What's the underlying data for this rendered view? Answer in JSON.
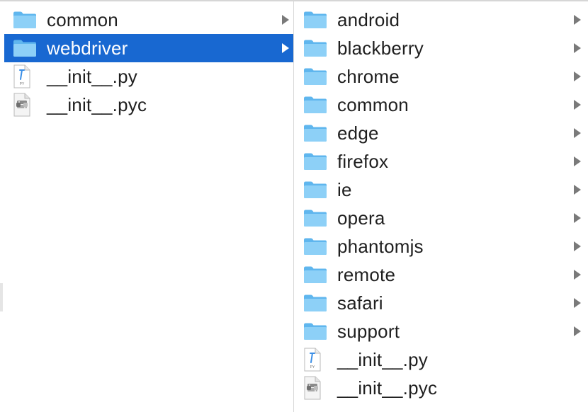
{
  "column1": {
    "items": [
      {
        "label": "common",
        "type": "folder",
        "has_children": true,
        "selected": false
      },
      {
        "label": "webdriver",
        "type": "folder",
        "has_children": true,
        "selected": true
      },
      {
        "label": "__init__.py",
        "type": "python-file",
        "has_children": false,
        "selected": false
      },
      {
        "label": "__init__.pyc",
        "type": "compiled-python-file",
        "has_children": false,
        "selected": false
      }
    ]
  },
  "column2": {
    "items": [
      {
        "label": "android",
        "type": "folder",
        "has_children": true
      },
      {
        "label": "blackberry",
        "type": "folder",
        "has_children": true
      },
      {
        "label": "chrome",
        "type": "folder",
        "has_children": true
      },
      {
        "label": "common",
        "type": "folder",
        "has_children": true
      },
      {
        "label": "edge",
        "type": "folder",
        "has_children": true
      },
      {
        "label": "firefox",
        "type": "folder",
        "has_children": true
      },
      {
        "label": "ie",
        "type": "folder",
        "has_children": true
      },
      {
        "label": "opera",
        "type": "folder",
        "has_children": true
      },
      {
        "label": "phantomjs",
        "type": "folder",
        "has_children": true
      },
      {
        "label": "remote",
        "type": "folder",
        "has_children": true
      },
      {
        "label": "safari",
        "type": "folder",
        "has_children": true
      },
      {
        "label": "support",
        "type": "folder",
        "has_children": true
      },
      {
        "label": "__init__.py",
        "type": "python-file",
        "has_children": false
      },
      {
        "label": "__init__.pyc",
        "type": "compiled-python-file",
        "has_children": false
      }
    ]
  },
  "icons": {
    "folder": "folder-icon",
    "python-file": "python-file-icon",
    "compiled-python-file": "compiled-python-file-icon",
    "chevron": "chevron-right-icon",
    "py_badge": "PY"
  },
  "colors": {
    "selection": "#1868d1",
    "folder_light": "#8dd0f7",
    "folder_dark": "#5fb6ee",
    "text": "#1f1f1f",
    "chevron": "#7a7a7a"
  }
}
